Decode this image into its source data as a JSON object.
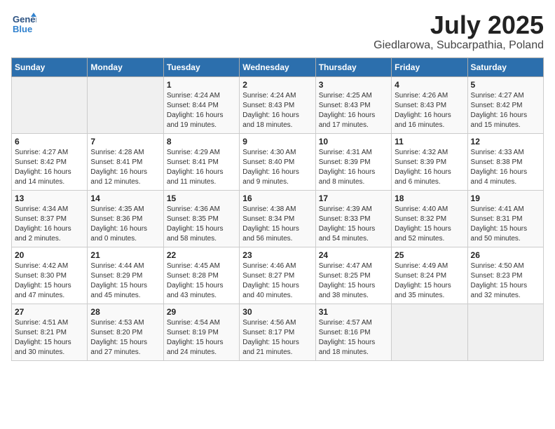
{
  "header": {
    "logo_general": "General",
    "logo_blue": "Blue",
    "month": "July 2025",
    "location": "Giedlarowa, Subcarpathia, Poland"
  },
  "weekdays": [
    "Sunday",
    "Monday",
    "Tuesday",
    "Wednesday",
    "Thursday",
    "Friday",
    "Saturday"
  ],
  "weeks": [
    [
      {
        "num": "",
        "detail": ""
      },
      {
        "num": "",
        "detail": ""
      },
      {
        "num": "1",
        "detail": "Sunrise: 4:24 AM\nSunset: 8:44 PM\nDaylight: 16 hours\nand 19 minutes."
      },
      {
        "num": "2",
        "detail": "Sunrise: 4:24 AM\nSunset: 8:43 PM\nDaylight: 16 hours\nand 18 minutes."
      },
      {
        "num": "3",
        "detail": "Sunrise: 4:25 AM\nSunset: 8:43 PM\nDaylight: 16 hours\nand 17 minutes."
      },
      {
        "num": "4",
        "detail": "Sunrise: 4:26 AM\nSunset: 8:43 PM\nDaylight: 16 hours\nand 16 minutes."
      },
      {
        "num": "5",
        "detail": "Sunrise: 4:27 AM\nSunset: 8:42 PM\nDaylight: 16 hours\nand 15 minutes."
      }
    ],
    [
      {
        "num": "6",
        "detail": "Sunrise: 4:27 AM\nSunset: 8:42 PM\nDaylight: 16 hours\nand 14 minutes."
      },
      {
        "num": "7",
        "detail": "Sunrise: 4:28 AM\nSunset: 8:41 PM\nDaylight: 16 hours\nand 12 minutes."
      },
      {
        "num": "8",
        "detail": "Sunrise: 4:29 AM\nSunset: 8:41 PM\nDaylight: 16 hours\nand 11 minutes."
      },
      {
        "num": "9",
        "detail": "Sunrise: 4:30 AM\nSunset: 8:40 PM\nDaylight: 16 hours\nand 9 minutes."
      },
      {
        "num": "10",
        "detail": "Sunrise: 4:31 AM\nSunset: 8:39 PM\nDaylight: 16 hours\nand 8 minutes."
      },
      {
        "num": "11",
        "detail": "Sunrise: 4:32 AM\nSunset: 8:39 PM\nDaylight: 16 hours\nand 6 minutes."
      },
      {
        "num": "12",
        "detail": "Sunrise: 4:33 AM\nSunset: 8:38 PM\nDaylight: 16 hours\nand 4 minutes."
      }
    ],
    [
      {
        "num": "13",
        "detail": "Sunrise: 4:34 AM\nSunset: 8:37 PM\nDaylight: 16 hours\nand 2 minutes."
      },
      {
        "num": "14",
        "detail": "Sunrise: 4:35 AM\nSunset: 8:36 PM\nDaylight: 16 hours\nand 0 minutes."
      },
      {
        "num": "15",
        "detail": "Sunrise: 4:36 AM\nSunset: 8:35 PM\nDaylight: 15 hours\nand 58 minutes."
      },
      {
        "num": "16",
        "detail": "Sunrise: 4:38 AM\nSunset: 8:34 PM\nDaylight: 15 hours\nand 56 minutes."
      },
      {
        "num": "17",
        "detail": "Sunrise: 4:39 AM\nSunset: 8:33 PM\nDaylight: 15 hours\nand 54 minutes."
      },
      {
        "num": "18",
        "detail": "Sunrise: 4:40 AM\nSunset: 8:32 PM\nDaylight: 15 hours\nand 52 minutes."
      },
      {
        "num": "19",
        "detail": "Sunrise: 4:41 AM\nSunset: 8:31 PM\nDaylight: 15 hours\nand 50 minutes."
      }
    ],
    [
      {
        "num": "20",
        "detail": "Sunrise: 4:42 AM\nSunset: 8:30 PM\nDaylight: 15 hours\nand 47 minutes."
      },
      {
        "num": "21",
        "detail": "Sunrise: 4:44 AM\nSunset: 8:29 PM\nDaylight: 15 hours\nand 45 minutes."
      },
      {
        "num": "22",
        "detail": "Sunrise: 4:45 AM\nSunset: 8:28 PM\nDaylight: 15 hours\nand 43 minutes."
      },
      {
        "num": "23",
        "detail": "Sunrise: 4:46 AM\nSunset: 8:27 PM\nDaylight: 15 hours\nand 40 minutes."
      },
      {
        "num": "24",
        "detail": "Sunrise: 4:47 AM\nSunset: 8:25 PM\nDaylight: 15 hours\nand 38 minutes."
      },
      {
        "num": "25",
        "detail": "Sunrise: 4:49 AM\nSunset: 8:24 PM\nDaylight: 15 hours\nand 35 minutes."
      },
      {
        "num": "26",
        "detail": "Sunrise: 4:50 AM\nSunset: 8:23 PM\nDaylight: 15 hours\nand 32 minutes."
      }
    ],
    [
      {
        "num": "27",
        "detail": "Sunrise: 4:51 AM\nSunset: 8:21 PM\nDaylight: 15 hours\nand 30 minutes."
      },
      {
        "num": "28",
        "detail": "Sunrise: 4:53 AM\nSunset: 8:20 PM\nDaylight: 15 hours\nand 27 minutes."
      },
      {
        "num": "29",
        "detail": "Sunrise: 4:54 AM\nSunset: 8:19 PM\nDaylight: 15 hours\nand 24 minutes."
      },
      {
        "num": "30",
        "detail": "Sunrise: 4:56 AM\nSunset: 8:17 PM\nDaylight: 15 hours\nand 21 minutes."
      },
      {
        "num": "31",
        "detail": "Sunrise: 4:57 AM\nSunset: 8:16 PM\nDaylight: 15 hours\nand 18 minutes."
      },
      {
        "num": "",
        "detail": ""
      },
      {
        "num": "",
        "detail": ""
      }
    ]
  ]
}
